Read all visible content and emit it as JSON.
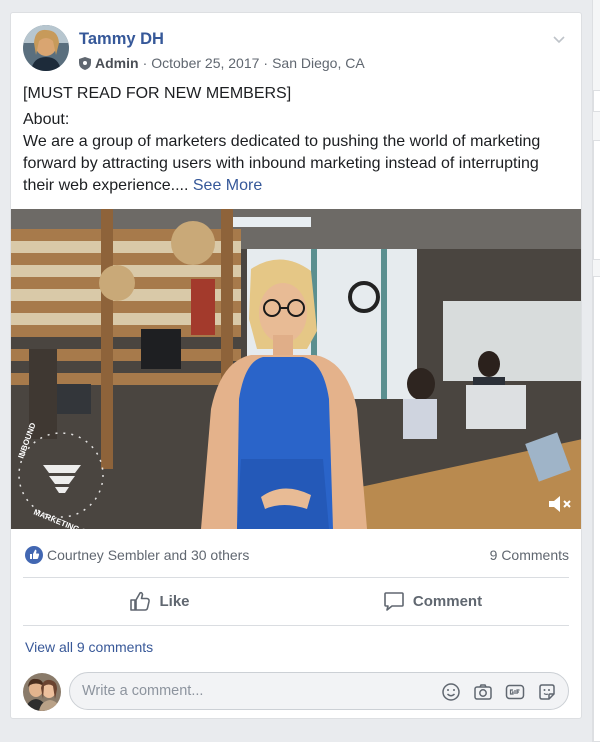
{
  "post": {
    "author": "Tammy DH",
    "role": "Admin",
    "date": "October 25, 2017",
    "location": "San Diego, CA",
    "separator": "·",
    "title_line": "[MUST READ FOR NEW MEMBERS]",
    "about_label": "About:",
    "body": "We are a group of marketers dedicated to pushing the world of marketing forward by attracting users with inbound marketing instead of interrupting their web experience....",
    "see_more": "See More"
  },
  "video": {
    "watermark_top": "INBOUND",
    "watermark_bottom": "MARKETING CREATORS",
    "icons": [
      "mute-icon"
    ]
  },
  "reactions": {
    "names": "Courtney Sembler and 30 others",
    "comments_count": "9 Comments"
  },
  "actions": {
    "like_label": "Like",
    "comment_label": "Comment"
  },
  "comments": {
    "view_all": "View all 9 comments",
    "placeholder": "Write a comment..."
  },
  "composer_icons": [
    "emoji-icon",
    "camera-icon",
    "gif-icon",
    "sticker-icon"
  ],
  "colors": {
    "link": "#365899",
    "like_blue": "#4267b2",
    "muted_text": "#606770",
    "video_dress": "#2a64c9"
  }
}
